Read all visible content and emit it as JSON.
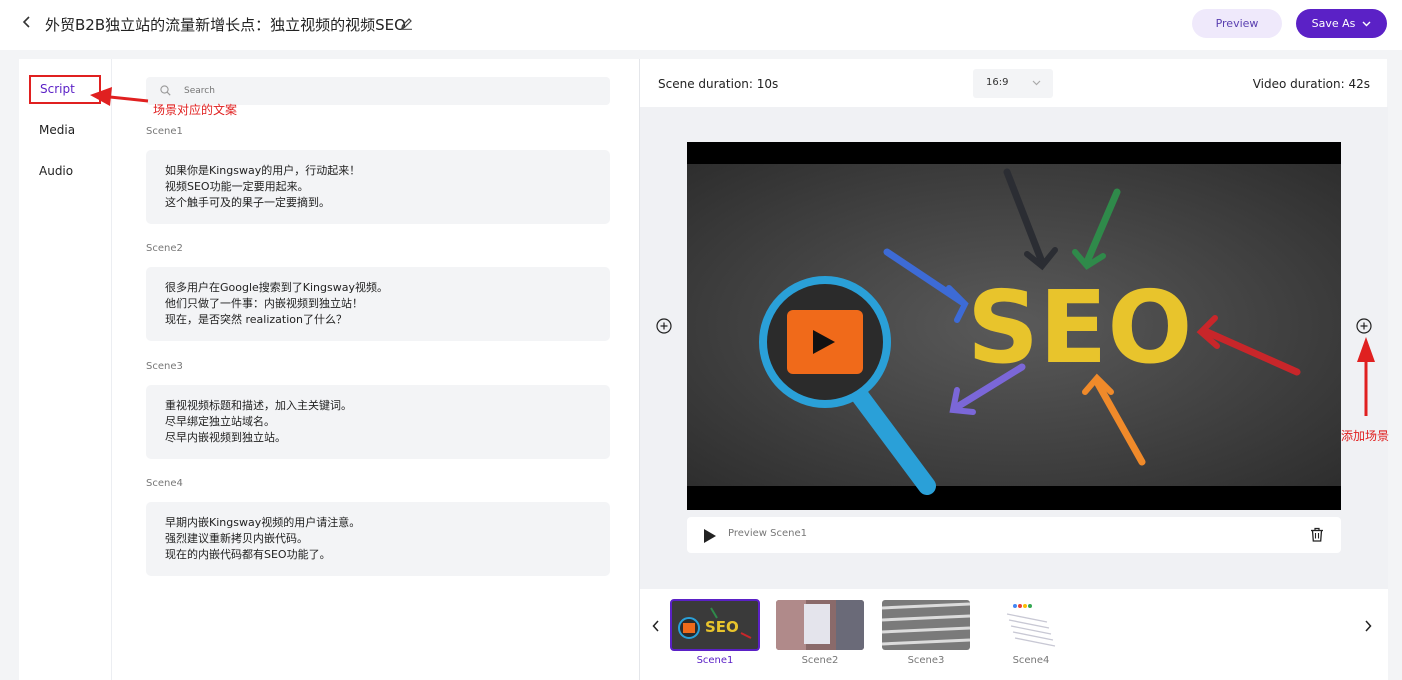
{
  "header": {
    "title": "外贸B2B独立站的流量新增长点：独立视频的视频SEO",
    "preview_label": "Preview",
    "save_label": "Save As"
  },
  "tabs": [
    {
      "label": "Script",
      "active": true
    },
    {
      "label": "Media",
      "active": false
    },
    {
      "label": "Audio",
      "active": false
    }
  ],
  "annotations": {
    "script_note": "场景对应的文案",
    "add_scene_note": "添加场景"
  },
  "search": {
    "placeholder": "Search"
  },
  "scenes": [
    {
      "label": "Scene1",
      "lines": [
        "如果你是Kingsway的用户，行动起来！",
        "视频SEO功能一定要用起来。",
        "这个触手可及的果子一定要摘到。"
      ]
    },
    {
      "label": "Scene2",
      "lines": [
        "很多用户在Google搜索到了Kingsway视频。",
        "他们只做了一件事：内嵌视频到独立站！",
        "现在，是否突然 realization了什么？"
      ]
    },
    {
      "label": "Scene3",
      "lines": [
        "重视视频标题和描述，加入主关键词。",
        "尽早绑定独立站域名。",
        "尽早内嵌视频到独立站。"
      ]
    },
    {
      "label": "Scene4",
      "lines": [
        "早期内嵌Kingsway视频的用户请注意。",
        "强烈建议重新拷贝内嵌代码。",
        "现在的内嵌代码都有SEO功能了。"
      ]
    }
  ],
  "preview": {
    "scene_duration": "Scene duration: 10s",
    "aspect_ratio": "16:9",
    "video_duration": "Video duration: 42s",
    "preview_scene_label": "Preview Scene1",
    "video_text": "SEO"
  },
  "filmstrip": [
    {
      "label": "Scene1",
      "selected": true
    },
    {
      "label": "Scene2",
      "selected": false
    },
    {
      "label": "Scene3",
      "selected": false
    },
    {
      "label": "Scene4",
      "selected": false
    }
  ],
  "colors": {
    "accent": "#5b21c6",
    "annotation": "#e02020"
  }
}
